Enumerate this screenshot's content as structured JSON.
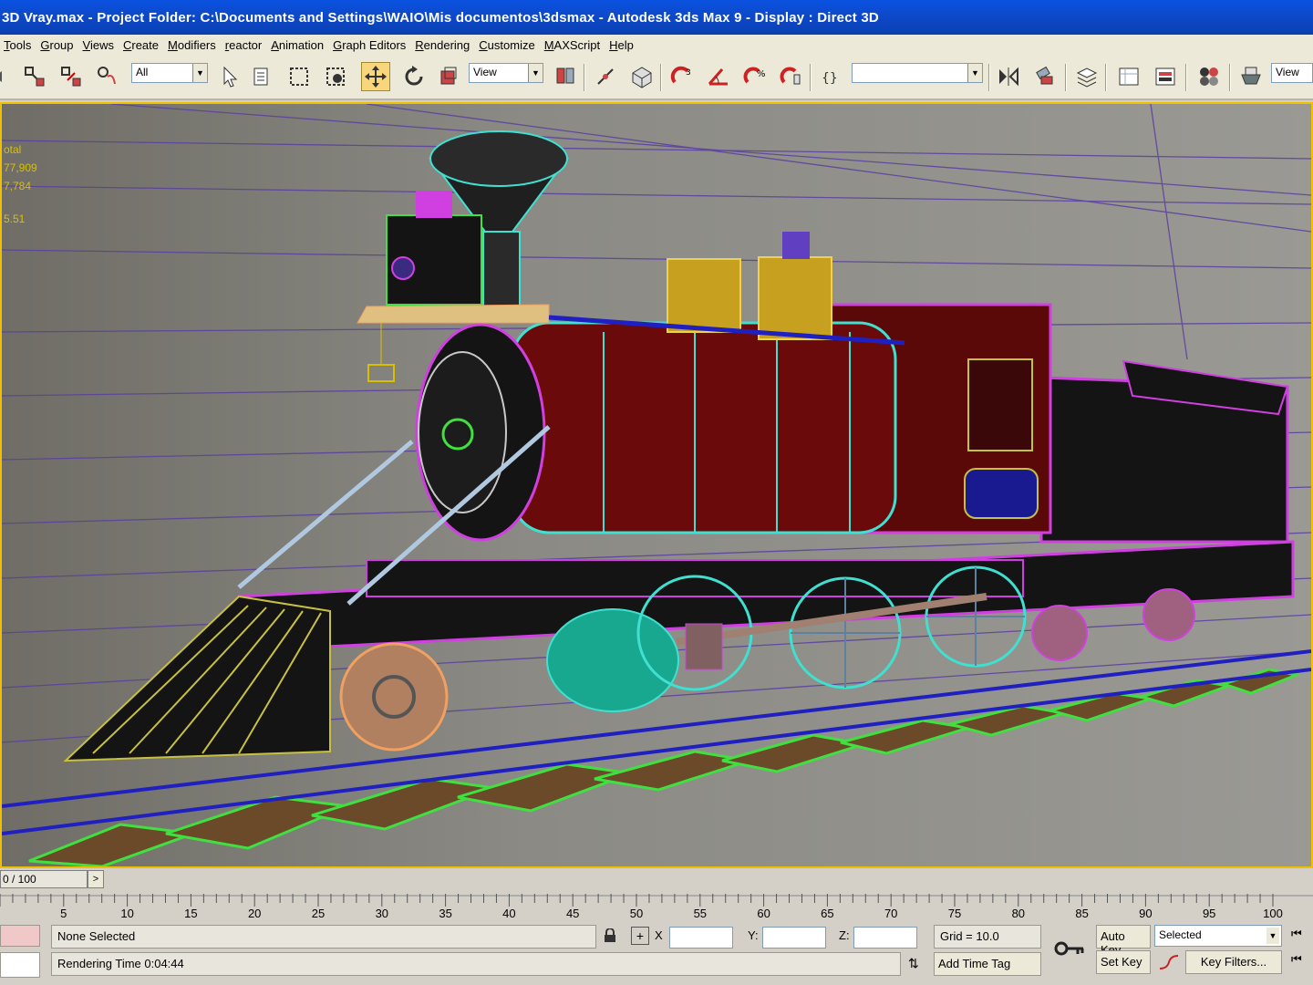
{
  "window": {
    "title": "3D Vray.max     - Project Folder: C:\\Documents and Settings\\WAIO\\Mis documentos\\3dsmax     - Autodesk 3ds Max 9     - Display : Direct 3D"
  },
  "menu": [
    "Tools",
    "Group",
    "Views",
    "Create",
    "Modifiers",
    "reactor",
    "Animation",
    "Graph Editors",
    "Rendering",
    "Customize",
    "MAXScript",
    "Help"
  ],
  "toolbar": {
    "selection_filter": "All",
    "ref_coord": "View",
    "named_selection": "",
    "view_right": "View"
  },
  "viewport": {
    "stats": [
      "otal",
      "77,909",
      "7,784",
      "5.51"
    ]
  },
  "timeslider": {
    "frame": "0 / 100",
    "next_arrow": ">"
  },
  "trackbar": {
    "ticks": [
      "5",
      "10",
      "15",
      "20",
      "25",
      "30",
      "35",
      "40",
      "45",
      "50",
      "55",
      "60",
      "65",
      "70",
      "75",
      "80",
      "85",
      "90",
      "95",
      "100"
    ]
  },
  "status": {
    "selection": "None Selected",
    "prompt": "Rendering Time  0:04:44",
    "x_label": "X",
    "y_label": "Y:",
    "z_label": "Z:",
    "x_value": "",
    "y_value": "",
    "z_value": "",
    "grid": "Grid = 10.0",
    "add_time_tag": "Add Time Tag",
    "auto_key": "Auto Key",
    "set_key": "Set Key",
    "key_mode": "Selected",
    "key_filters": "Key Filters..."
  },
  "colors": {
    "titlebar": "#0a52e0",
    "viewport_border": "#f0c000",
    "wire_magenta": "#d040e0",
    "wire_cyan": "#40e0d0",
    "wire_green": "#40e040"
  }
}
